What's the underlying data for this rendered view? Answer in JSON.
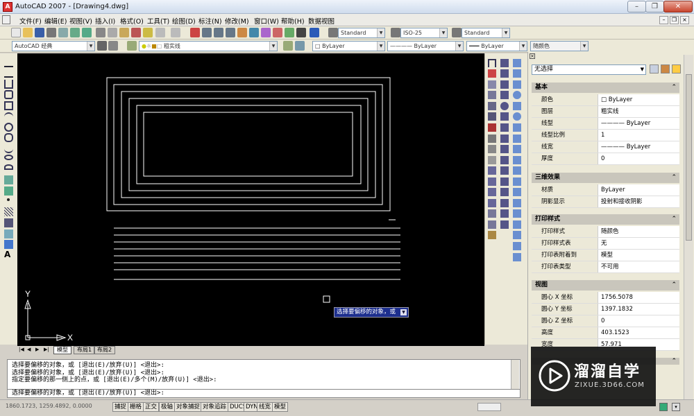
{
  "app": {
    "title": "AutoCAD 2007 - [Drawing4.dwg]"
  },
  "menu": [
    "文件(F)",
    "编辑(E)",
    "视图(V)",
    "插入(I)",
    "格式(O)",
    "工具(T)",
    "绘图(D)",
    "标注(N)",
    "修改(M)",
    "窗口(W)",
    "帮助(H)",
    "数据视图"
  ],
  "styles": {
    "text_style": "Standard",
    "dim_style": "ISO-25",
    "table_style": "Standard"
  },
  "layers": {
    "workspace": "AutoCAD 经典",
    "current_layer": "粗实线",
    "color": "ByLayer",
    "linetype": "ByLayer",
    "lineweight": "ByLayer",
    "plotstyle": "随颜色"
  },
  "tooltip": "选择要偏移的对象，或",
  "ucs": {
    "x": "X",
    "y": "Y"
  },
  "tabs": [
    "模型",
    "布局1",
    "布局2"
  ],
  "properties": {
    "selection": "无选择",
    "sections": [
      {
        "title": "基本",
        "rows": [
          {
            "k": "颜色",
            "v": "ByLayer",
            "swatch": true
          },
          {
            "k": "图层",
            "v": "粗实线"
          },
          {
            "k": "线型",
            "v": "ByLayer",
            "line": true
          },
          {
            "k": "线型比例",
            "v": "1"
          },
          {
            "k": "线宽",
            "v": "ByLayer",
            "line": true
          },
          {
            "k": "厚度",
            "v": "0"
          }
        ]
      },
      {
        "title": "三维效果",
        "rows": [
          {
            "k": "材质",
            "v": "ByLayer"
          },
          {
            "k": "阴影显示",
            "v": "投射和接收阴影"
          }
        ]
      },
      {
        "title": "打印样式",
        "rows": [
          {
            "k": "打印样式",
            "v": "随颜色"
          },
          {
            "k": "打印样式表",
            "v": "无"
          },
          {
            "k": "打印表附着到",
            "v": "模型"
          },
          {
            "k": "打印表类型",
            "v": "不可用"
          }
        ]
      },
      {
        "title": "视图",
        "rows": [
          {
            "k": "圆心 X 坐标",
            "v": "1756.5078"
          },
          {
            "k": "圆心 Y 坐标",
            "v": "1397.1832"
          },
          {
            "k": "圆心 Z 坐标",
            "v": "0"
          },
          {
            "k": "高度",
            "v": "403.1523"
          },
          {
            "k": "宽度",
            "v": "57.971"
          }
        ]
      }
    ]
  },
  "command": {
    "history": [
      "选择要偏移的对象，或 [退出(E)/放弃(U)] <退出>:",
      "选择要偏移的对象，或 [退出(E)/放弃(U)] <退出>:",
      "指定要偏移的那一侧上的点，或 [退出(E)/多个(M)/放弃(U)] <退出>:"
    ],
    "input": "选择要偏移的对象，或 [退出(E)/放弃(U)] <退出>:"
  },
  "status": {
    "coords": "1860.1723, 1259.4892, 0.0000",
    "buttons": [
      "捕捉",
      "栅格",
      "正交",
      "极轴",
      "对象捕捉",
      "对象追踪",
      "DUCS",
      "DYN",
      "线宽",
      "模型"
    ]
  },
  "watermark": {
    "brand": "溜溜自学",
    "url": "ZIXUE.3D66.COM"
  }
}
